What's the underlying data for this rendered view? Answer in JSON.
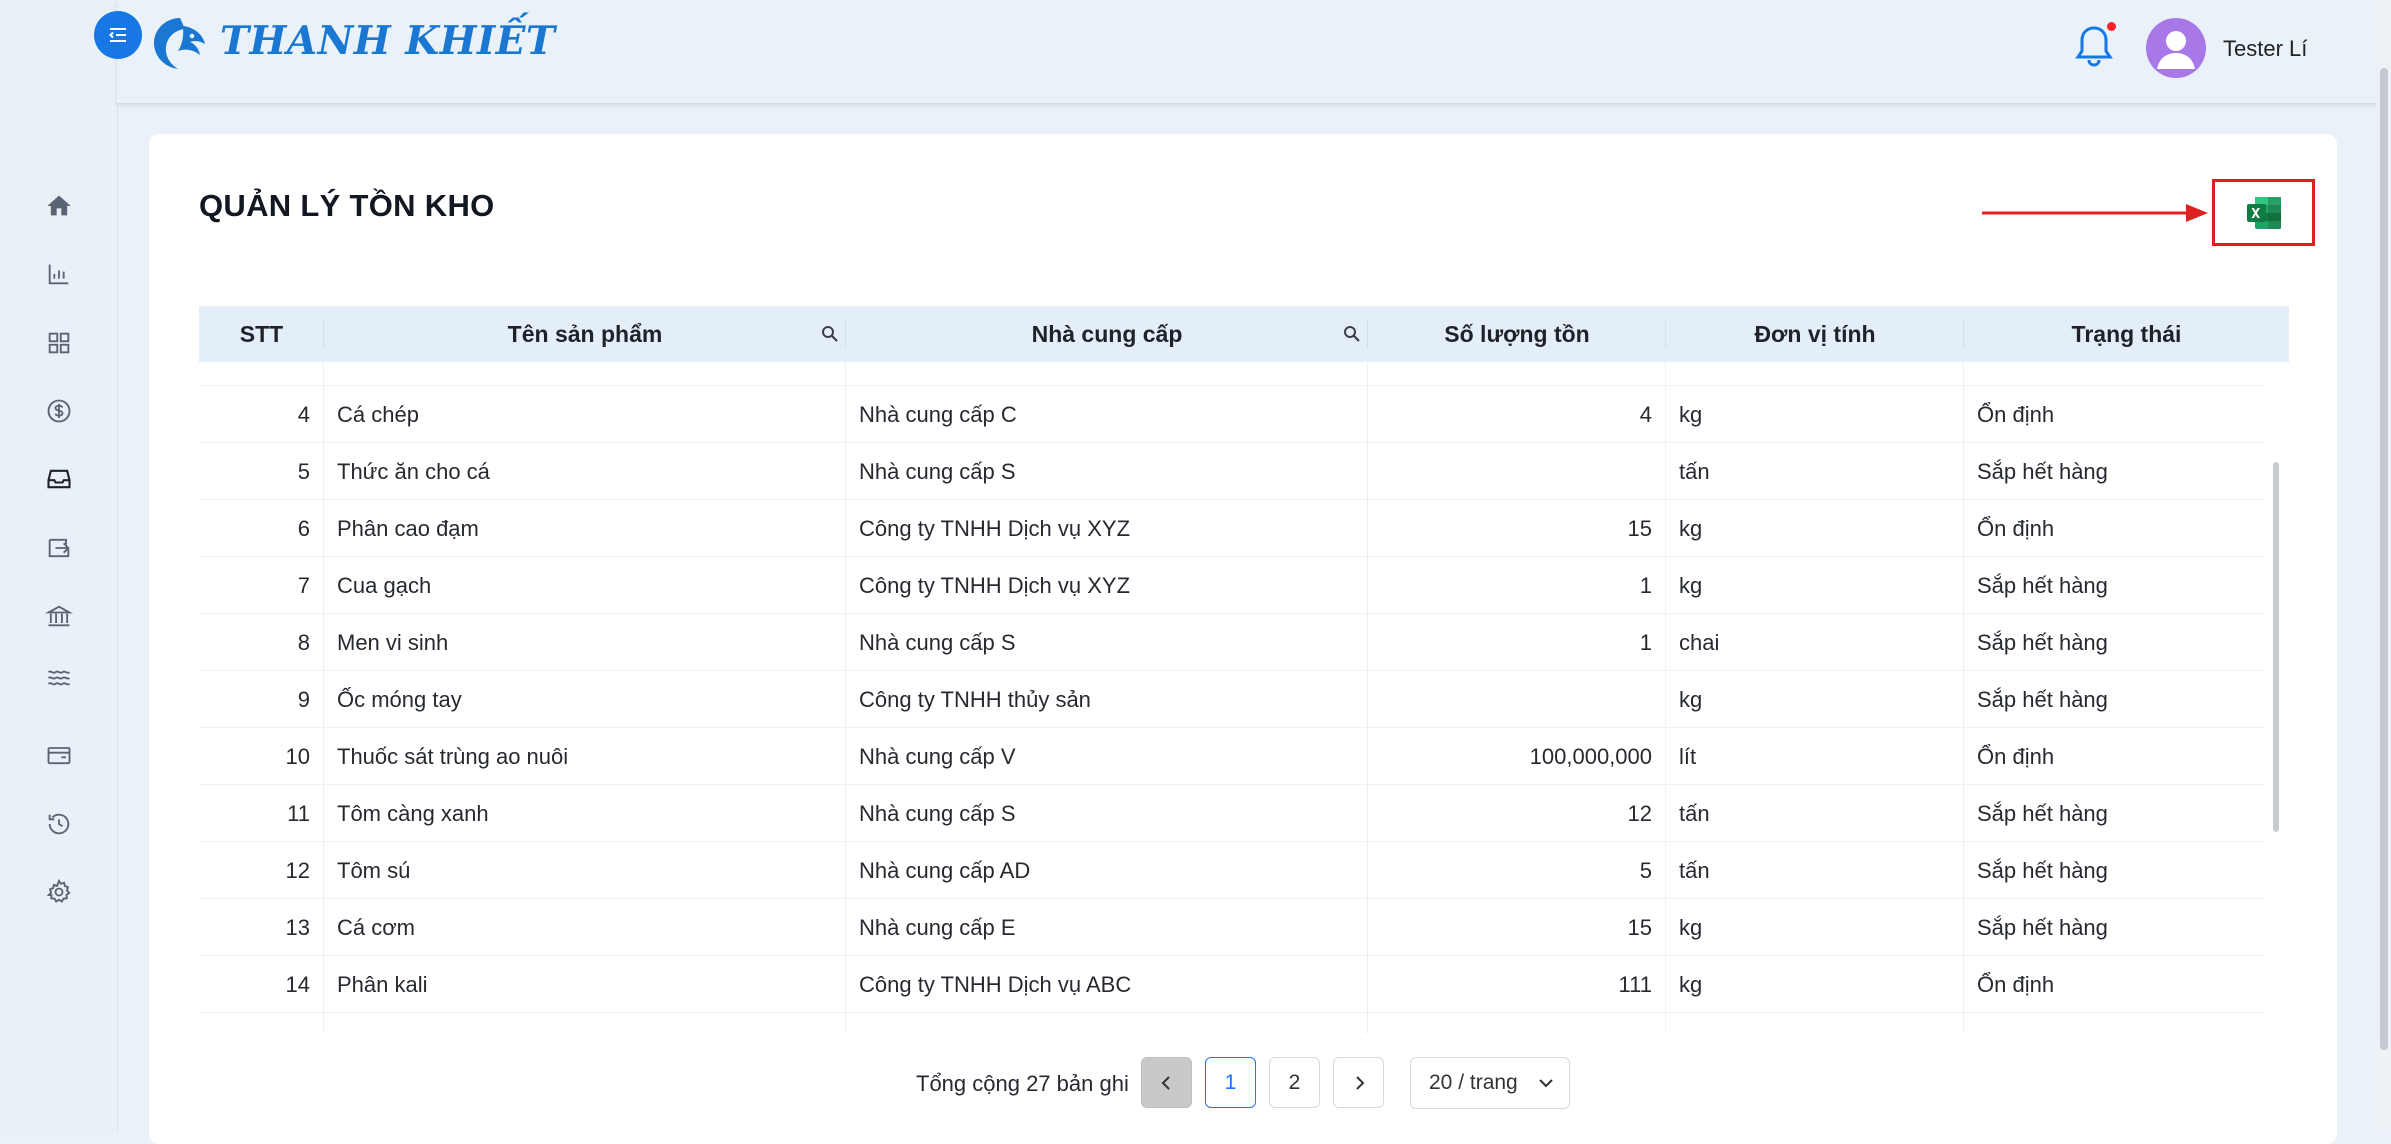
{
  "app": {
    "logo_text": "THANH KHIẾT"
  },
  "header": {
    "username": "Tester Lí",
    "notification_dot": true
  },
  "sidebar": {
    "items": [
      {
        "icon": "home-icon"
      },
      {
        "icon": "bar-chart-icon"
      },
      {
        "icon": "dashboard-grid-icon"
      },
      {
        "icon": "dollar-circle-icon"
      },
      {
        "icon": "inbox-icon",
        "active": true
      },
      {
        "icon": "import-export-icon"
      },
      {
        "icon": "bank-icon"
      },
      {
        "icon": "water-waves-icon"
      },
      {
        "icon": "wallet-icon"
      },
      {
        "icon": "history-clock-icon"
      },
      {
        "icon": "settings-gear-icon"
      }
    ]
  },
  "page": {
    "title": "QUẢN LÝ TỒN KHO",
    "export_icon": "excel-icon"
  },
  "table": {
    "columns": [
      "STT",
      "Tên sản phẩm",
      "Nhà cung cấp",
      "Số lượng tồn",
      "Đơn vị tính",
      "Trạng thái"
    ],
    "rows": [
      {
        "stt": "4",
        "name": "Cá chép",
        "supplier": "Nhà cung cấp C",
        "qty": "4",
        "unit": "kg",
        "status": "Ổn định"
      },
      {
        "stt": "5",
        "name": "Thức ăn cho cá",
        "supplier": "Nhà cung cấp S",
        "qty": "",
        "unit": "tấn",
        "status": "Sắp hết hàng"
      },
      {
        "stt": "6",
        "name": "Phân cao đạm",
        "supplier": "Công ty TNHH Dịch vụ XYZ",
        "qty": "15",
        "unit": "kg",
        "status": "Ổn định"
      },
      {
        "stt": "7",
        "name": "Cua gạch",
        "supplier": "Công ty TNHH Dịch vụ XYZ",
        "qty": "1",
        "unit": "kg",
        "status": "Sắp hết hàng"
      },
      {
        "stt": "8",
        "name": "Men vi sinh",
        "supplier": "Nhà cung cấp S",
        "qty": "1",
        "unit": "chai",
        "status": "Sắp hết hàng"
      },
      {
        "stt": "9",
        "name": "Ốc móng tay",
        "supplier": "Công ty TNHH thủy sản",
        "qty": "",
        "unit": "kg",
        "status": "Sắp hết hàng"
      },
      {
        "stt": "10",
        "name": "Thuốc sát trùng ao nuôi",
        "supplier": "Nhà cung cấp V",
        "qty": "100,000,000",
        "unit": "lít",
        "status": "Ổn định"
      },
      {
        "stt": "11",
        "name": "Tôm càng xanh",
        "supplier": "Nhà cung cấp S",
        "qty": "12",
        "unit": "tấn",
        "status": "Sắp hết hàng"
      },
      {
        "stt": "12",
        "name": "Tôm sú",
        "supplier": "Nhà cung cấp AD",
        "qty": "5",
        "unit": "tấn",
        "status": "Sắp hết hàng"
      },
      {
        "stt": "13",
        "name": "Cá cơm",
        "supplier": "Nhà cung cấp E",
        "qty": "15",
        "unit": "kg",
        "status": "Sắp hết hàng"
      },
      {
        "stt": "14",
        "name": "Phân kali",
        "supplier": "Công ty TNHH Dịch vụ ABC",
        "qty": "111",
        "unit": "kg",
        "status": "Ổn định"
      }
    ]
  },
  "pagination": {
    "total_text": "Tổng cộng 27 bản ghi",
    "pages": [
      "1",
      "2"
    ],
    "current_page": "1",
    "page_size": "20 / trang"
  }
}
